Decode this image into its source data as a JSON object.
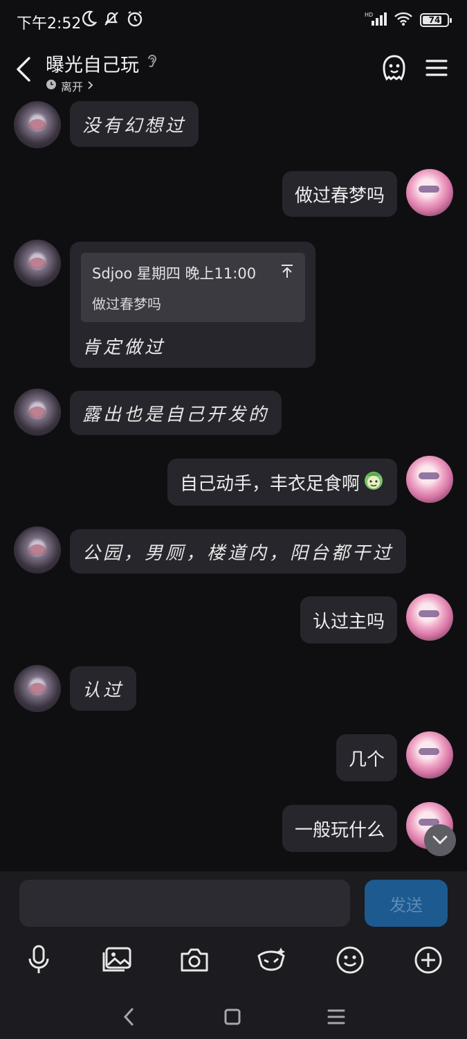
{
  "status_bar": {
    "time": "下午2:52",
    "battery": "74",
    "network": "HD"
  },
  "header": {
    "title": "曝光自己玩",
    "status": "离开"
  },
  "messages": [
    {
      "side": "left",
      "text": "没有幻想过"
    },
    {
      "side": "right",
      "text": "做过春梦吗"
    },
    {
      "side": "left",
      "quote_sender": "Sdjoo 星期四 晚上11:00",
      "quote_text": "做过春梦吗",
      "text": "肯定做过"
    },
    {
      "side": "left",
      "text": "露出也是自己开发的"
    },
    {
      "side": "right",
      "text": "自己动手，丰衣足食啊"
    },
    {
      "side": "left",
      "text": "公园，男厕，楼道内，阳台都干过"
    },
    {
      "side": "right",
      "text": "认过主吗"
    },
    {
      "side": "left",
      "text": "认过"
    },
    {
      "side": "right",
      "text": "几个"
    },
    {
      "side": "right",
      "text": "一般玩什么"
    }
  ],
  "input": {
    "placeholder": "",
    "send_label": "发送"
  },
  "toolbar": {
    "items": [
      "microphone-icon",
      "image-icon",
      "camera-icon",
      "emoji-mask-icon",
      "smiley-icon",
      "plus-icon"
    ]
  },
  "colors": {
    "background": "#0f0f12",
    "bubble": "#26262c",
    "send": "#1d5a8f"
  }
}
